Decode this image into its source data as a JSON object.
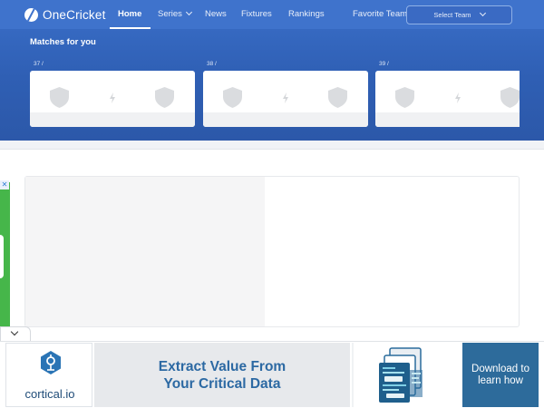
{
  "header": {
    "brand": "OneCricket",
    "nav": [
      {
        "label": "Home",
        "active": true
      },
      {
        "label": "Series",
        "dropdown": true
      },
      {
        "label": "News"
      },
      {
        "label": "Fixtures"
      },
      {
        "label": "Rankings"
      }
    ],
    "favorite_label": "Favorite Team",
    "select_team": "Select Team",
    "colors": {
      "band": "#2f5fb4",
      "nav": "#3f73cc"
    }
  },
  "matches": {
    "title": "Matches for you",
    "cards": [
      {
        "number": "37 /"
      },
      {
        "number": "38 /"
      },
      {
        "number": "39 /"
      }
    ]
  },
  "banner_ad": {
    "brand": "cortical.io",
    "headline_line1": "Extract Value From",
    "headline_line2": "Your Critical Data",
    "cta_line1": "Download to",
    "cta_line2": "learn how",
    "close_icon": "close-icon",
    "colors": {
      "headline": "#2c69a3",
      "cta_bg": "#2d6b9b"
    }
  }
}
